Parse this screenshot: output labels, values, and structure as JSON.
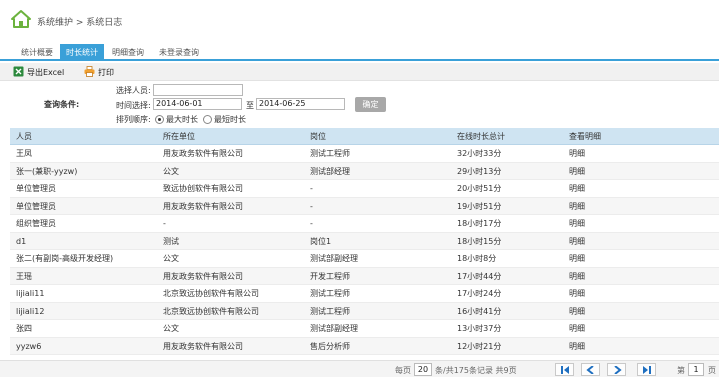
{
  "header": {
    "breadcrumb": "系统维护 > 系统日志"
  },
  "tabs": [
    {
      "label": "统计概要"
    },
    {
      "label": "时长统计",
      "active": true
    },
    {
      "label": "明细查询"
    },
    {
      "label": "未登录查询"
    }
  ],
  "toolbar": {
    "export_label": "导出Excel",
    "print_label": "打印"
  },
  "filters": {
    "condition_label": "查询条件:",
    "person_label": "选择人员:",
    "person_value": "",
    "time_label": "时间选择:",
    "date_from": "2014-06-01",
    "to_label": "至",
    "date_to": "2014-06-25",
    "confirm_label": "确定",
    "sort_label": "排列顺序:",
    "sort_options": [
      {
        "label": "最大时长",
        "selected": true
      },
      {
        "label": "最短时长",
        "selected": false
      }
    ]
  },
  "table": {
    "columns": [
      "人员",
      "所在单位",
      "岗位",
      "在线时长总计",
      "查看明细"
    ],
    "rows": [
      [
        "王凤",
        "用友政务软件有限公司",
        "测试工程师",
        "32小时33分",
        "明细"
      ],
      [
        "张一(兼职-yyzw)",
        "公文",
        "测试部经理",
        "29小时13分",
        "明细"
      ],
      [
        "单位管理员",
        "致远协创软件有限公司",
        "-",
        "20小时51分",
        "明细"
      ],
      [
        "单位管理员",
        "用友政务软件有限公司",
        "-",
        "19小时51分",
        "明细"
      ],
      [
        "组织管理员",
        "-",
        "-",
        "18小时17分",
        "明细"
      ],
      [
        "d1",
        "测试",
        "岗位1",
        "18小时15分",
        "明细"
      ],
      [
        "张二(有副岗-高级开发经理)",
        "公文",
        "测试部副经理",
        "18小时8分",
        "明细"
      ],
      [
        "王瑶",
        "用友政务软件有限公司",
        "开发工程师",
        "17小时44分",
        "明细"
      ],
      [
        "lijiali11",
        "北京致远协创软件有限公司",
        "测试工程师",
        "17小时24分",
        "明细"
      ],
      [
        "lijiali12",
        "北京致远协创软件有限公司",
        "测试工程师",
        "16小时41分",
        "明细"
      ],
      [
        "张四",
        "公文",
        "测试部副经理",
        "13小时37分",
        "明细"
      ],
      [
        "yyzw6",
        "用友政务软件有限公司",
        "售后分析师",
        "12小时21分",
        "明细"
      ]
    ]
  },
  "pager": {
    "per_page_prefix": "每页",
    "per_page_value": "20",
    "summary": "条/共175条记录  共9页",
    "page_prefix": "第",
    "page_value": "1",
    "page_suffix": "页"
  },
  "colors": {
    "accent": "#3aa0d8",
    "header_row": "#cfe4f2",
    "link": "#1e6fd0",
    "pager_arrow": "#1f6fc0"
  },
  "icons": [
    "home-icon",
    "excel-icon",
    "printer-icon",
    "first-page-icon",
    "prev-page-icon",
    "next-page-icon",
    "last-page-icon"
  ]
}
